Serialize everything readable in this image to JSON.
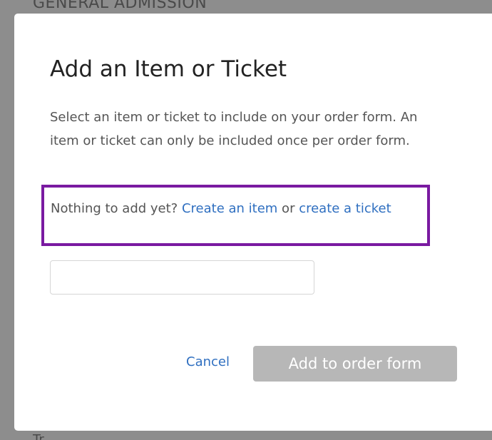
{
  "background": {
    "heading": "GENERAL ADMISSION",
    "footer_text": "Tr..."
  },
  "modal": {
    "title": "Add an Item or Ticket",
    "description": "Select an item or ticket to include on your order form. An item or ticket can only be included once per order form.",
    "callout": {
      "prefix": "Nothing to add yet? ",
      "create_item_link": "Create an item",
      "connector": " or ",
      "create_ticket_link": "create a ticket"
    },
    "item_select": {
      "value": ""
    },
    "cancel_label": "Cancel",
    "submit_label": "Add to order form"
  },
  "colors": {
    "overlay": "#8d8d8d",
    "link": "#2f6fc0",
    "callout_border": "#7a1aa1",
    "disabled_button": "#b7b7b7"
  }
}
